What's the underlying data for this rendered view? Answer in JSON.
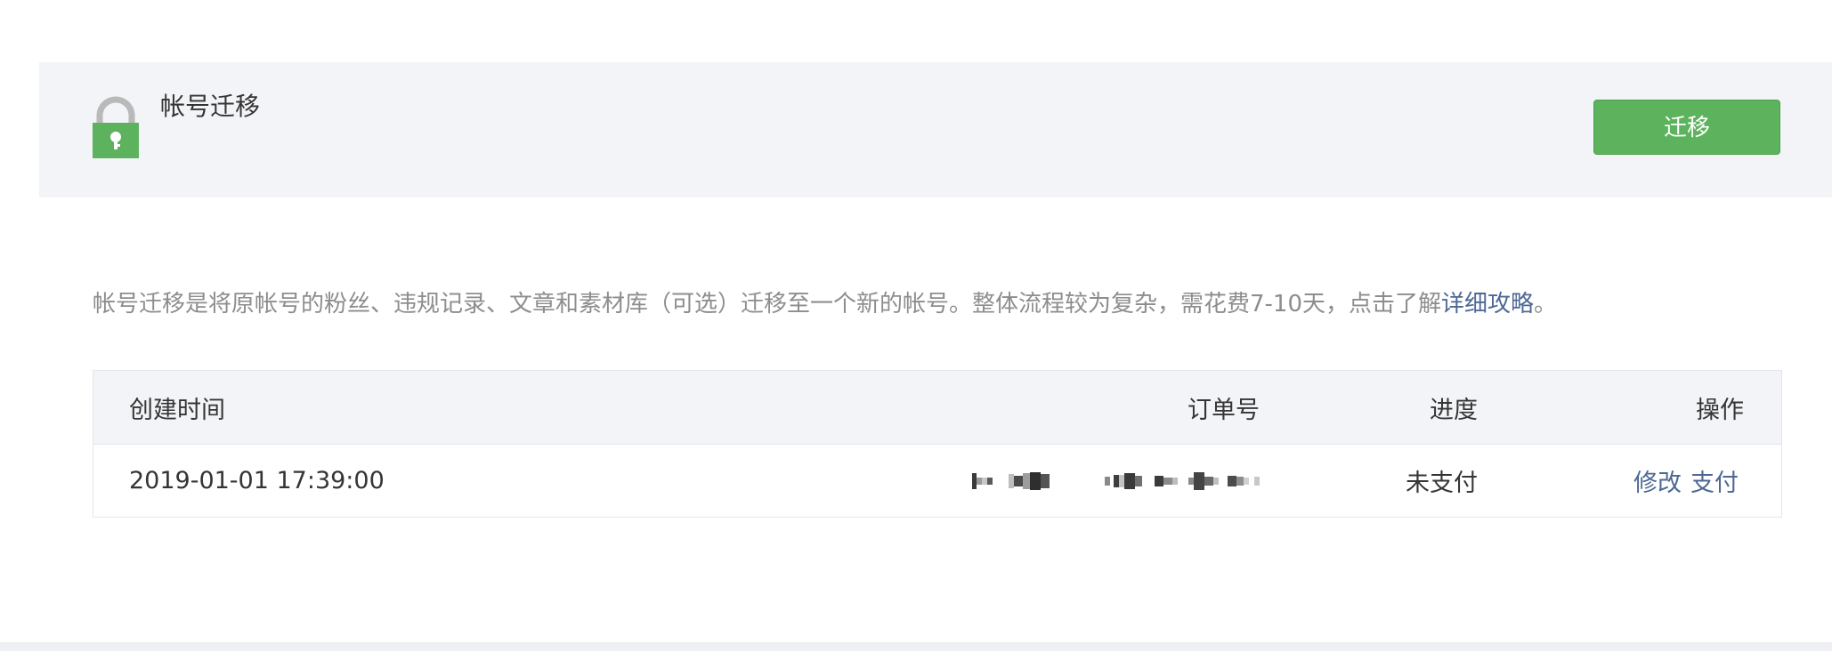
{
  "panel": {
    "title": "帐号迁移",
    "migrate_button": "迁移"
  },
  "description": {
    "text": "帐号迁移是将原帐号的粉丝、违规记录、文章和素材库（可选）迁移至一个新的帐号。整体流程较为复杂，需花费7-10天，点击了解",
    "link": "详细攻略",
    "suffix": "。"
  },
  "table": {
    "headers": {
      "created_time": "创建时间",
      "order_no": "订单号",
      "progress": "进度",
      "actions": "操作"
    },
    "rows": [
      {
        "created_time": "2019-01-01 17:39:00",
        "progress": "未支付",
        "edit": "修改",
        "pay": "支付"
      }
    ]
  },
  "colors": {
    "primary_green": "#5db35d",
    "link_blue": "#4d6894",
    "panel_bg": "#f3f4f7"
  },
  "icons": {
    "lock": "unlocked-padlock-icon"
  }
}
